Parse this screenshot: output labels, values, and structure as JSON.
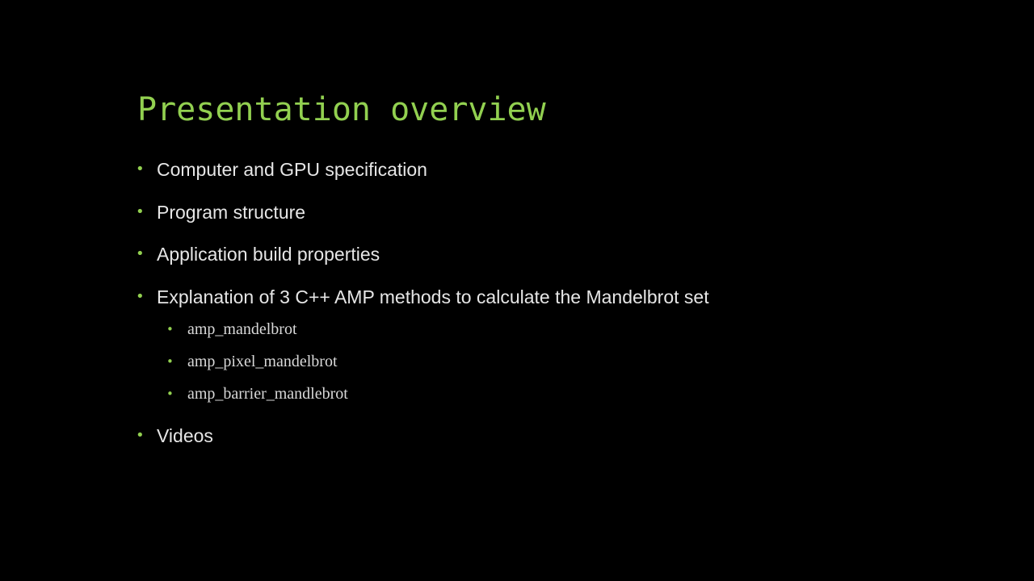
{
  "slide": {
    "title": "Presentation overview",
    "bullets": [
      "Computer and GPU specification",
      "Program structure",
      "Application build properties",
      "Explanation of 3 C++ AMP methods to calculate the Mandelbrot set"
    ],
    "sub_bullets": [
      "amp_mandelbrot",
      "amp_pixel_mandelbrot",
      "amp_barrier_mandlebrot"
    ],
    "last_bullet": "Videos",
    "bullet_glyph": "•"
  },
  "colors": {
    "background": "#000000",
    "title": "#92d050",
    "bullet_marker": "#92d050",
    "text": "#e6e6e6"
  }
}
